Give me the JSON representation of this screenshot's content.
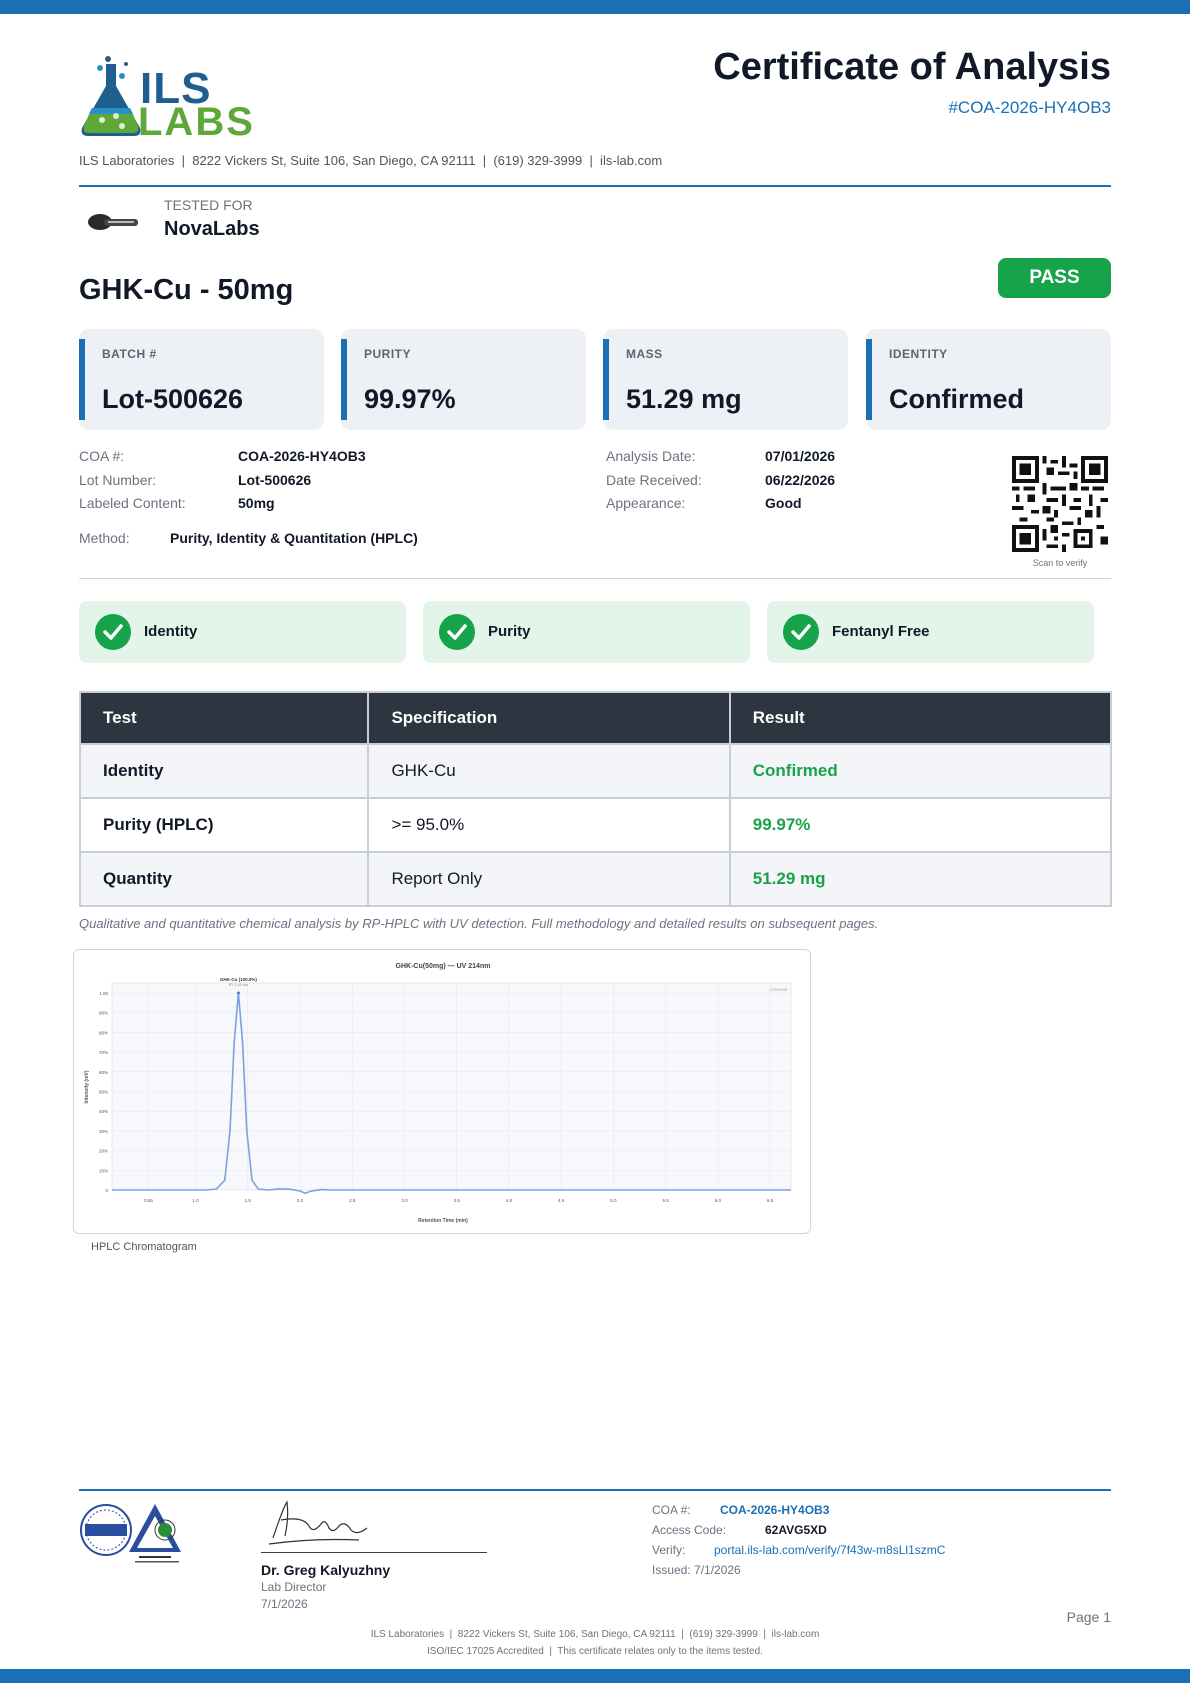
{
  "header": {
    "logo_top": "ILS",
    "logo_bottom": "LABS",
    "title": "Certificate of Analysis",
    "coa_id": "#COA-2026-HY4OB3",
    "lab_line": "ILS Laboratories  |  8222 Vickers St, Suite 106, San Diego, CA 92111  |  (619) 329-3999  |  ils-lab.com"
  },
  "client": {
    "tested_for_label": "TESTED FOR",
    "name": "NovaLabs"
  },
  "product": {
    "name": "GHK-Cu - 50mg",
    "status": "PASS"
  },
  "cards": [
    {
      "label": "BATCH #",
      "value": "Lot-500626"
    },
    {
      "label": "PURITY",
      "value": "99.97%"
    },
    {
      "label": "MASS",
      "value": "51.29 mg"
    },
    {
      "label": "IDENTITY",
      "value": "Confirmed"
    }
  ],
  "details": {
    "left": [
      {
        "label": "COA #:",
        "value": "COA-2026-HY4OB3"
      },
      {
        "label": "Lot Number:",
        "value": "Lot-500626"
      },
      {
        "label": "Labeled Content:",
        "value": "50mg"
      }
    ],
    "right": [
      {
        "label": "Analysis Date:",
        "value": "07/01/2026"
      },
      {
        "label": "Date Received:",
        "value": "06/22/2026"
      },
      {
        "label": "Appearance:",
        "value": "Good"
      }
    ],
    "method_label": "Method:",
    "method_value": "Purity, Identity & Quantitation (HPLC)",
    "qr_caption": "Scan to verify"
  },
  "badges": [
    "Identity",
    "Purity",
    "Fentanyl Free"
  ],
  "results": {
    "headers": [
      "Test",
      "Specification",
      "Result"
    ],
    "rows": [
      {
        "test": "Identity",
        "spec": "GHK-Cu",
        "result": "Confirmed"
      },
      {
        "test": "Purity (HPLC)",
        "spec": ">= 95.0%",
        "result": "99.97%"
      },
      {
        "test": "Quantity",
        "spec": "Report Only",
        "result": "51.29 mg"
      }
    ],
    "note": "Qualitative and quantitative chemical analysis by RP-HPLC with UV detection. Full methodology and detailed results on subsequent pages."
  },
  "chart_data": {
    "type": "line",
    "title": "GHK-Cu(50mg) — UV 214nm",
    "xlabel": "Retention Time (min)",
    "ylabel": "Intensity (mV)",
    "legend": "Channel",
    "peak_label": "GHK-Cu (100.0%)",
    "peak_sublabel": "RT: 1.41 min",
    "x_ticks": [
      "0.55",
      "1.0",
      "1.5",
      "2.0",
      "2.5",
      "3.0",
      "3.5",
      "4.0",
      "4.5",
      "5.0",
      "5.5",
      "6.0",
      "6.5"
    ],
    "y_ticks": [
      "0",
      "10%",
      "20%",
      "30%",
      "40%",
      "50%",
      "60%",
      "70%",
      "80%",
      "90%",
      "1.00"
    ],
    "xlim": [
      0.2,
      6.7
    ],
    "ylim": [
      0,
      100
    ],
    "series": [
      {
        "x": [
          0.2,
          1.1,
          1.2,
          1.28,
          1.33,
          1.37,
          1.41,
          1.45,
          1.49,
          1.54,
          1.6,
          1.7,
          1.8,
          1.9,
          2.0,
          2.05,
          2.1,
          2.2,
          2.3,
          4.0,
          6.7
        ],
        "y": [
          0,
          0,
          0.5,
          5,
          30,
          75,
          100,
          75,
          30,
          5,
          0.5,
          0,
          0.6,
          0.4,
          -0.5,
          -1.6,
          -0.6,
          0.2,
          0,
          0,
          0
        ]
      }
    ],
    "caption": "HPLC Chromatogram"
  },
  "footer": {
    "sig_name": "Dr. Greg Kalyuzhny",
    "sig_role": "Lab Director",
    "sig_date": "7/1/2026",
    "coa_label": "COA #:",
    "coa_value": "COA-2026-HY4OB3",
    "access_label": "Access Code:",
    "access_value": "62AVG5XD",
    "verify_label": "Verify:",
    "verify_value": "portal.ils-lab.com/verify/7f43w-m8sLl1szmC",
    "issued": "Issued: 7/1/2026",
    "page": "Page 1",
    "line1": "ILS Laboratories  |  8222 Vickers St, Suite 106, San Diego, CA 92111  |  (619) 329-3999  |  ils-lab.com",
    "line2": "ISO/IEC 17025 Accredited  |  This certificate relates only to the items tested."
  }
}
